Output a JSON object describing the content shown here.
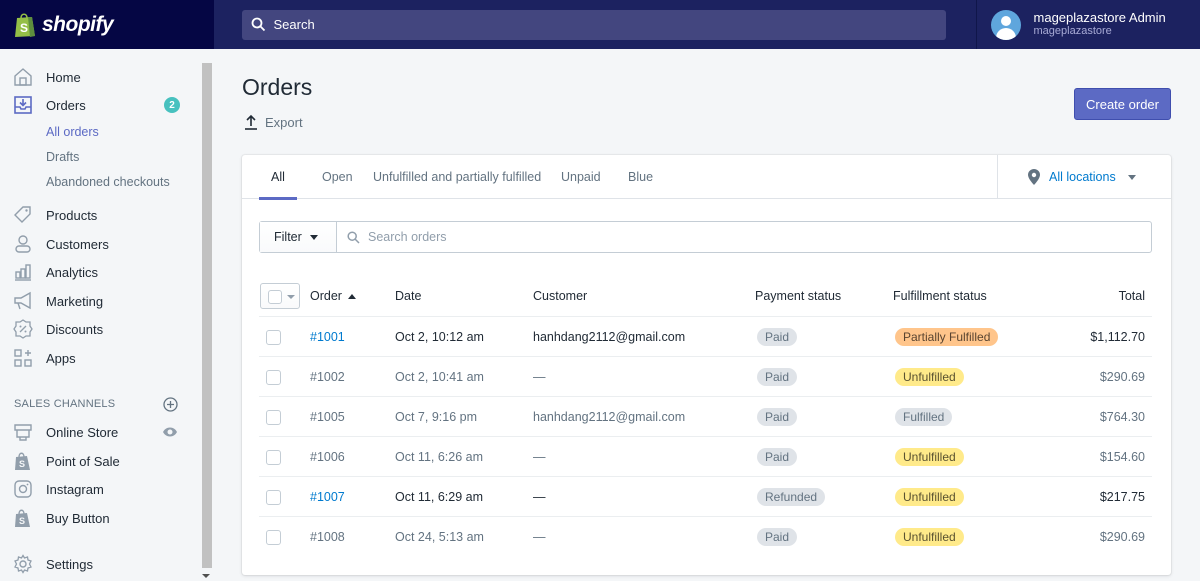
{
  "topbar": {
    "logo_text": "shopify",
    "search_placeholder": "Search",
    "user_name": "mageplazastore Admin",
    "user_store": "mageplazastore"
  },
  "sidebar": {
    "items": [
      {
        "label": "Home",
        "icon": "home-icon"
      },
      {
        "label": "Orders",
        "icon": "orders-icon",
        "badge": "2"
      },
      {
        "label": "Products",
        "icon": "tag-icon"
      },
      {
        "label": "Customers",
        "icon": "person-icon"
      },
      {
        "label": "Analytics",
        "icon": "bar-chart-icon"
      },
      {
        "label": "Marketing",
        "icon": "megaphone-icon"
      },
      {
        "label": "Discounts",
        "icon": "discount-icon"
      },
      {
        "label": "Apps",
        "icon": "apps-icon"
      }
    ],
    "orders_sub": [
      {
        "label": "All orders",
        "active": true
      },
      {
        "label": "Drafts"
      },
      {
        "label": "Abandoned checkouts"
      }
    ],
    "sales_channels_label": "SALES CHANNELS",
    "channels": [
      {
        "label": "Online Store",
        "icon": "store-icon"
      },
      {
        "label": "Point of Sale",
        "icon": "shopping-bag-icon"
      },
      {
        "label": "Instagram",
        "icon": "instagram-icon"
      },
      {
        "label": "Buy Button",
        "icon": "shopping-bag-icon"
      }
    ],
    "settings_label": "Settings"
  },
  "page": {
    "title": "Orders",
    "export_label": "Export",
    "create_order_label": "Create order"
  },
  "tabs": [
    {
      "label": "All",
      "active": true
    },
    {
      "label": "Open"
    },
    {
      "label": "Unfulfilled and partially fulfilled"
    },
    {
      "label": "Unpaid"
    },
    {
      "label": "Blue"
    }
  ],
  "location_filter": "All locations",
  "filter": {
    "button_label": "Filter",
    "search_placeholder": "Search orders"
  },
  "table": {
    "headers": {
      "order": "Order",
      "date": "Date",
      "customer": "Customer",
      "payment": "Payment status",
      "fulfillment": "Fulfillment status",
      "total": "Total"
    },
    "rows": [
      {
        "order": "#1001",
        "date": "Oct 2, 10:12 am",
        "customer": "hanhdang2112@gmail.com",
        "payment": "Paid",
        "fulfillment": "Partially Fulfilled",
        "fulfillment_color": "#ffc58b",
        "total": "$1,112.70",
        "unread": true
      },
      {
        "order": "#1002",
        "date": "Oct 2, 10:41 am",
        "customer": "—",
        "payment": "Paid",
        "fulfillment": "Unfulfilled",
        "fulfillment_color": "#ffea8a",
        "total": "$290.69",
        "unread": false
      },
      {
        "order": "#1005",
        "date": "Oct 7, 9:16 pm",
        "customer": "hanhdang2112@gmail.com",
        "payment": "Paid",
        "fulfillment": "Fulfilled",
        "fulfillment_color": "#dfe3e8",
        "total": "$764.30",
        "unread": false
      },
      {
        "order": "#1006",
        "date": "Oct 11, 6:26 am",
        "customer": "—",
        "payment": "Paid",
        "fulfillment": "Unfulfilled",
        "fulfillment_color": "#ffea8a",
        "total": "$154.60",
        "unread": false
      },
      {
        "order": "#1007",
        "date": "Oct 11, 6:29 am",
        "customer": "—",
        "payment": "Refunded",
        "fulfillment": "Unfulfilled",
        "fulfillment_color": "#ffea8a",
        "total": "$217.75",
        "unread": true
      },
      {
        "order": "#1008",
        "date": "Oct 24, 5:13 am",
        "customer": "—",
        "payment": "Paid",
        "fulfillment": "Unfulfilled",
        "fulfillment_color": "#ffea8a",
        "total": "$290.69",
        "unread": false
      }
    ]
  },
  "colors": {
    "topbar": "#1c2260",
    "logo_bg": "#050644",
    "accent": "#5c6ac4",
    "link": "#007ace",
    "badge_teal": "#47c1bf"
  }
}
